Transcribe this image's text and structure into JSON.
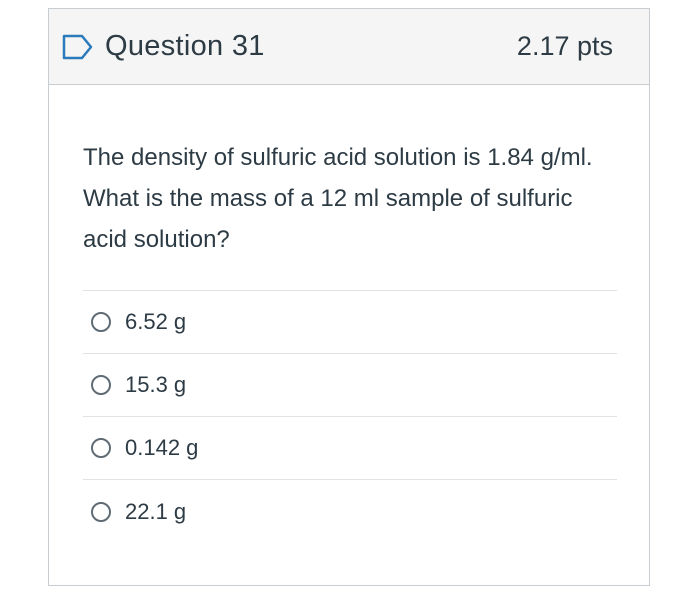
{
  "question": {
    "title": "Question 31",
    "points": "2.17 pts",
    "text": "The density of sulfuric acid solution is  1.84 g/ml.  What is the mass of a 12 ml sample of sulfuric acid solution?",
    "flag_icon": "flag-outline-icon",
    "accent_color": "#2b7abc"
  },
  "answers": [
    {
      "label": "6.52 g"
    },
    {
      "label": "15.3 g"
    },
    {
      "label": "0.142 g"
    },
    {
      "label": "22.1 g"
    }
  ]
}
